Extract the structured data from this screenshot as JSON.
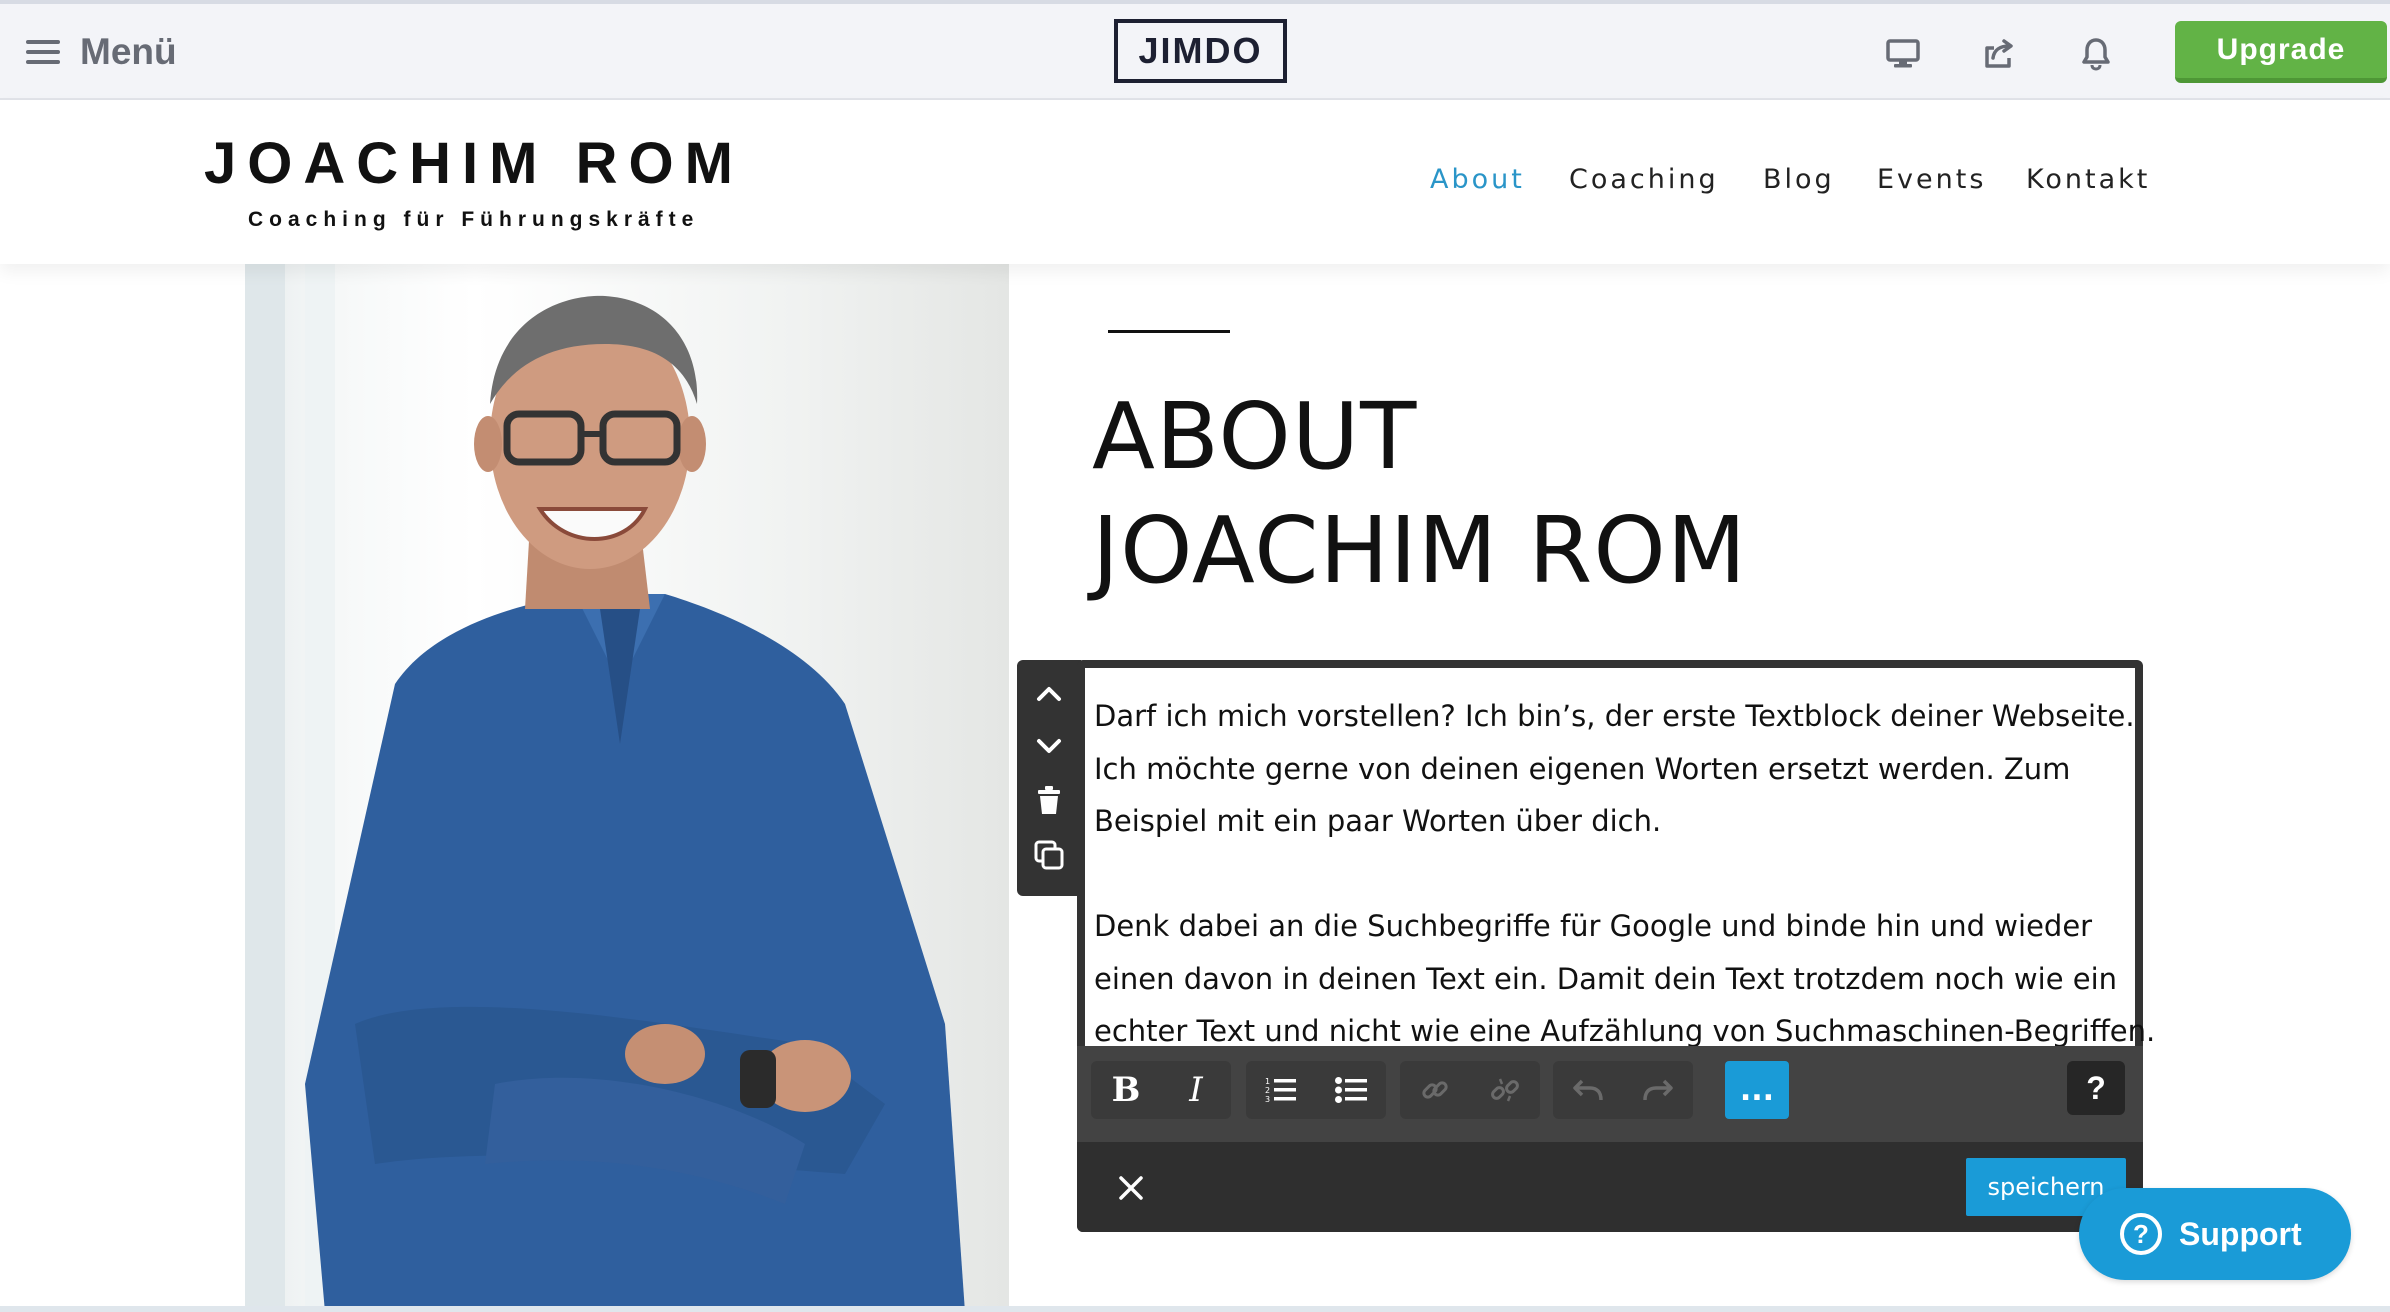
{
  "topbar": {
    "menu_label": "Menü",
    "logo_text": "JIMDO",
    "upgrade_label": "Upgrade",
    "icons": [
      "menu-icon",
      "desktop-preview-icon",
      "share-icon",
      "bell-icon"
    ]
  },
  "site": {
    "name": "JOACHIM ROM",
    "tagline": "Coaching für Führungskräfte",
    "nav": [
      {
        "label": "About",
        "active": true
      },
      {
        "label": "Coaching",
        "active": false
      },
      {
        "label": "Blog",
        "active": false
      },
      {
        "label": "Events",
        "active": false
      },
      {
        "label": "Kontakt",
        "active": false
      }
    ]
  },
  "page": {
    "title_line1": "ABOUT",
    "title_line2": "JOACHIM ROM",
    "photo_alt": "Portrait"
  },
  "editor": {
    "paragraph1_lines": [
      "Darf ich mich vorstellen? Ich bin’s, der erste Textblock deiner Webseite.",
      "Ich möchte gerne von deinen eigenen Worten ersetzt werden. Zum",
      "Beispiel mit ein paar Worten über dich."
    ],
    "paragraph2_lines": [
      "Denk dabei an die Suchbegriffe für Google und binde hin und wieder",
      "einen davon in deinen Text ein. Damit dein Text trotzdem noch wie ein",
      "echter Text und nicht wie eine Aufzählung von Suchmaschinen-Begriffen."
    ],
    "more_label": "...",
    "help_label": "?",
    "save_label": "speichern"
  },
  "support": {
    "label": "Support"
  },
  "colors": {
    "accent_blue": "#1a9bd7",
    "upgrade_green": "#62b346",
    "nav_active": "#2a95c8",
    "editor_dark": "#333333"
  }
}
